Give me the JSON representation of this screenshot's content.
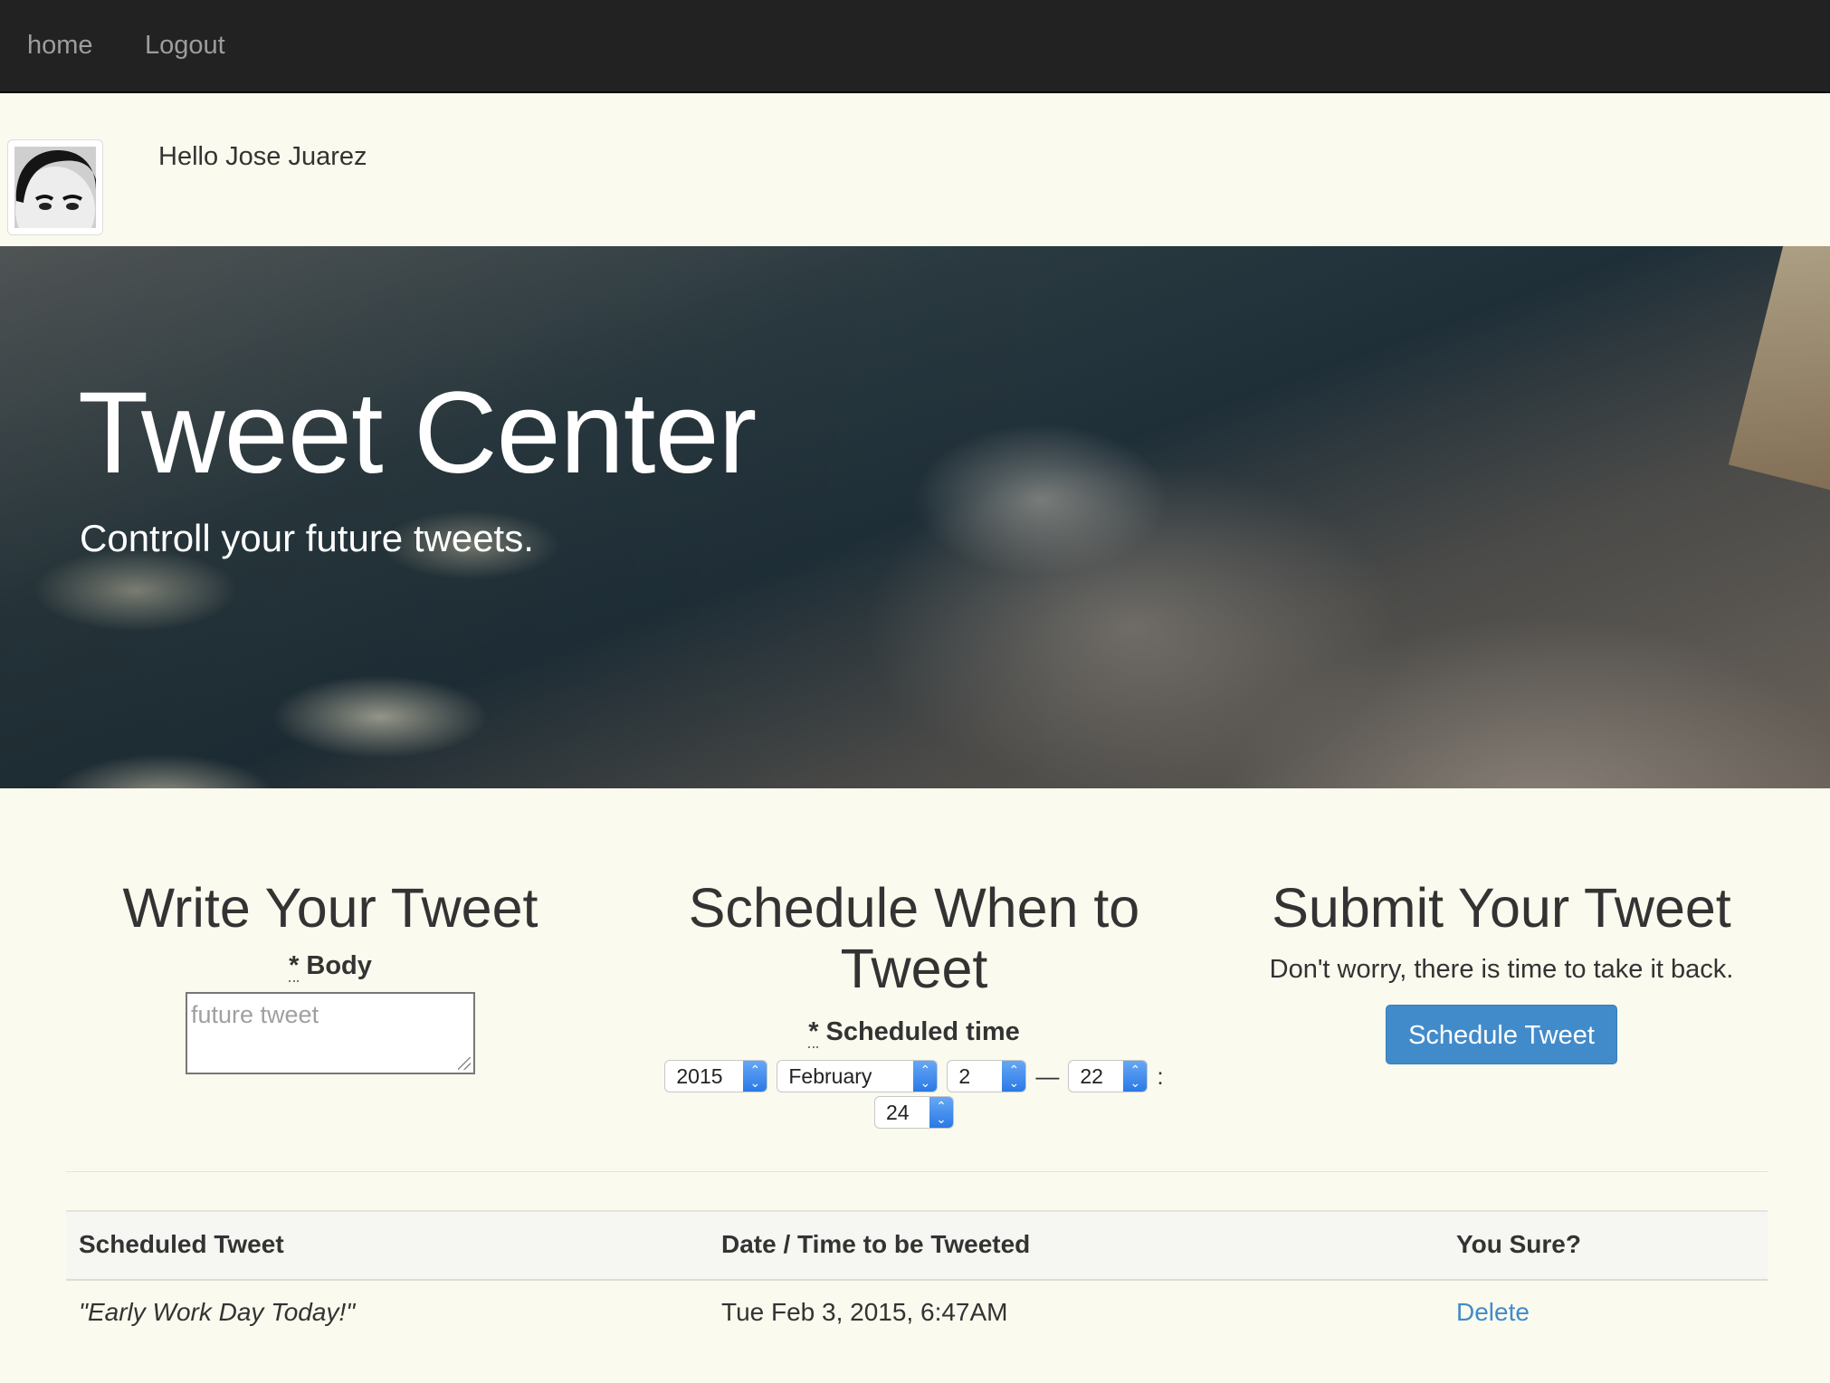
{
  "nav": {
    "home": "home",
    "logout": "Logout"
  },
  "user": {
    "greeting": "Hello Jose Juarez"
  },
  "hero": {
    "title": "Tweet Center",
    "subtitle": "Controll your future tweets."
  },
  "write": {
    "heading": "Write Your Tweet",
    "required_mark": "*",
    "label": "Body",
    "placeholder": "future tweet"
  },
  "schedule": {
    "heading": "Schedule When to Tweet",
    "required_mark": "*",
    "label": "Scheduled time",
    "year": "2015",
    "month": "February",
    "day": "2",
    "date_time_separator": "—",
    "hour": "22",
    "time_separator": ":",
    "minute": "24"
  },
  "submit": {
    "heading": "Submit Your Tweet",
    "text": "Don't worry, there is time to take it back.",
    "button": "Schedule Tweet"
  },
  "table": {
    "headers": [
      "Scheduled Tweet",
      "Date / Time to be Tweeted",
      "You Sure?"
    ],
    "rows": [
      {
        "tweet": "\"Early Work Day Today!\"",
        "datetime": "Tue Feb 3, 2015, 6:47AM",
        "action": "Delete"
      }
    ]
  },
  "colors": {
    "navbar": "#222222",
    "background": "#fafaee",
    "primary": "#428bca"
  }
}
